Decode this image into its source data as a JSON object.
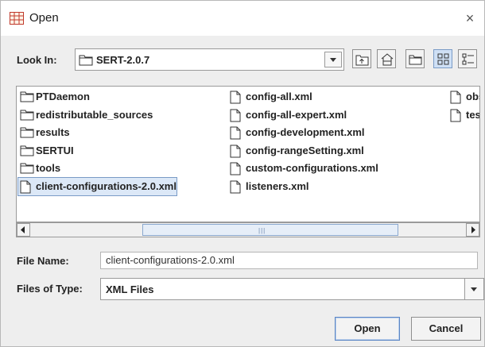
{
  "window": {
    "title": "Open",
    "close_glyph": "×"
  },
  "look_in": {
    "label": "Look In:",
    "value": "SERT-2.0.7"
  },
  "toolbar": {
    "buttons": [
      "up-one-level-icon",
      "home-icon",
      "new-folder-icon",
      "list-view-icon",
      "details-view-icon"
    ]
  },
  "files": {
    "columns": [
      [
        {
          "name": "PTDaemon",
          "type": "folder"
        },
        {
          "name": "redistributable_sources",
          "type": "folder"
        },
        {
          "name": "results",
          "type": "folder"
        },
        {
          "name": "SERTUI",
          "type": "folder"
        },
        {
          "name": "tools",
          "type": "folder"
        },
        {
          "name": "client-configurations-2.0.xml",
          "type": "file",
          "selected": true
        }
      ],
      [
        {
          "name": "config-all.xml",
          "type": "file"
        },
        {
          "name": "config-all-expert.xml",
          "type": "file"
        },
        {
          "name": "config-development.xml",
          "type": "file"
        },
        {
          "name": "config-rangeSetting.xml",
          "type": "file"
        },
        {
          "name": "custom-configurations.xml",
          "type": "file"
        },
        {
          "name": "listeners.xml",
          "type": "file"
        }
      ],
      [
        {
          "name": "obs",
          "type": "file"
        },
        {
          "name": "tes",
          "type": "file"
        }
      ]
    ]
  },
  "file_name": {
    "label": "File Name:",
    "value": "client-configurations-2.0.xml"
  },
  "file_type": {
    "label": "Files of Type:",
    "value": "XML Files"
  },
  "buttons": {
    "open": "Open",
    "cancel": "Cancel"
  },
  "scrollbar": {
    "grip": "|||"
  }
}
